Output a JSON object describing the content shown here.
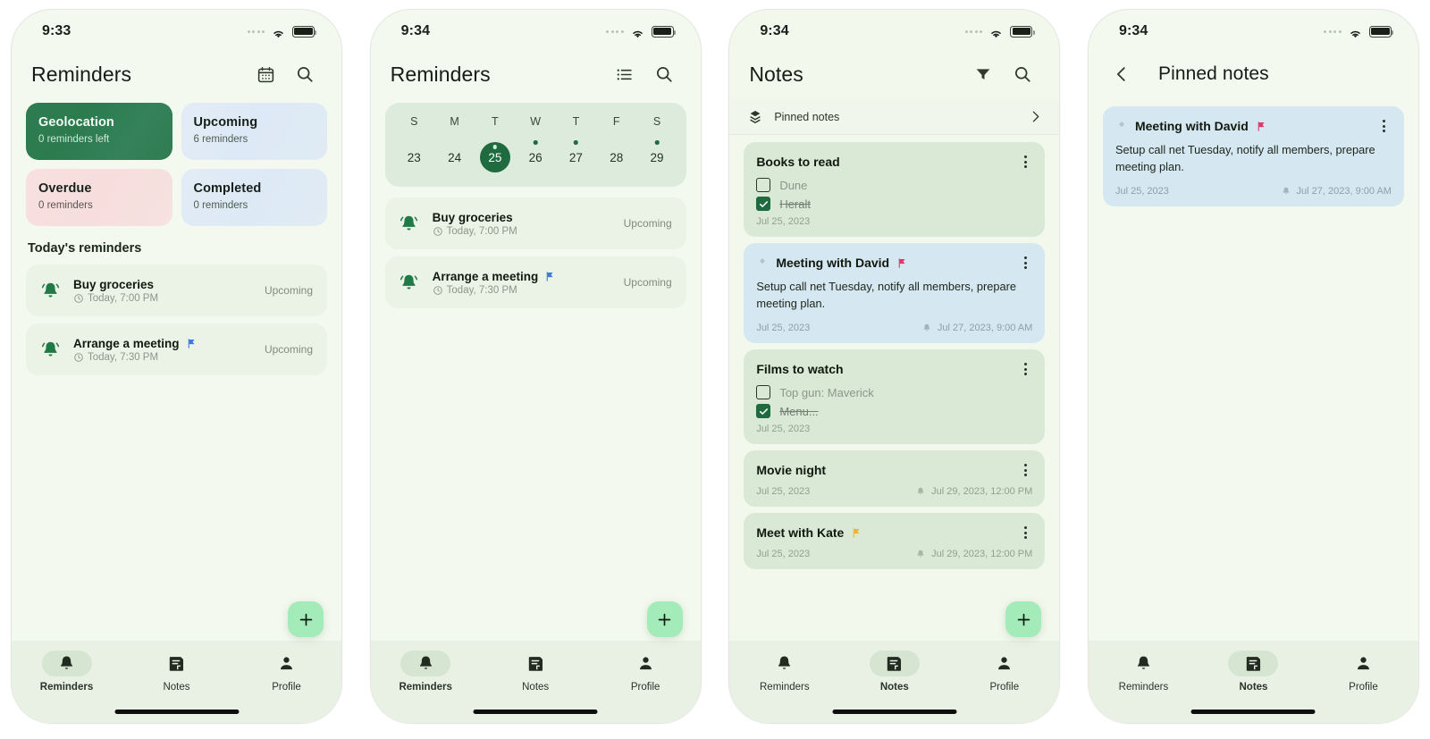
{
  "phones": [
    {
      "id": "reminders-home",
      "status": {
        "time": "9:33",
        "wifi_icon": "wifi-icon",
        "battery_icon": "battery-full-icon",
        "signal_icon": "signal-dots-icon"
      },
      "appbar": {
        "title": "Reminders",
        "icons": [
          "calendar-icon",
          "search-icon"
        ]
      },
      "tiles": [
        {
          "name": "Geolocation",
          "sub": "0 reminders left",
          "style": "geo"
        },
        {
          "name": "Upcoming",
          "sub": "6 reminders",
          "style": "upcoming"
        },
        {
          "name": "Overdue",
          "sub": "0 reminders",
          "style": "overdue"
        },
        {
          "name": "Completed",
          "sub": "0 reminders",
          "style": "completed"
        }
      ],
      "section_title": "Today's reminders",
      "reminders": [
        {
          "title": "Buy groceries",
          "time": "Today, 7:00 PM",
          "status": "Upcoming",
          "flag": false
        },
        {
          "title": "Arrange a meeting",
          "time": "Today, 7:30 PM",
          "status": "Upcoming",
          "flag": true,
          "flag_color": "#3f76e0"
        }
      ],
      "fab": {
        "label": "+",
        "name": "add-reminder-fab"
      },
      "nav": {
        "active": "Reminders",
        "items": [
          {
            "label": "Reminders",
            "icon": "bell-icon"
          },
          {
            "label": "Notes",
            "icon": "note-icon"
          },
          {
            "label": "Profile",
            "icon": "person-icon"
          }
        ]
      }
    },
    {
      "id": "reminders-calendar",
      "status": {
        "time": "9:34",
        "wifi_icon": "wifi-icon",
        "battery_icon": "battery-full-icon",
        "signal_icon": "signal-dots-icon"
      },
      "appbar": {
        "title": "Reminders",
        "icons": [
          "list-view-icon",
          "search-icon"
        ]
      },
      "calendar": {
        "dow": [
          "S",
          "M",
          "T",
          "W",
          "T",
          "F",
          "S"
        ],
        "days": [
          {
            "num": "23",
            "dot": false,
            "selected": false
          },
          {
            "num": "24",
            "dot": false,
            "selected": false
          },
          {
            "num": "25",
            "dot": true,
            "selected": true
          },
          {
            "num": "26",
            "dot": true,
            "selected": false
          },
          {
            "num": "27",
            "dot": true,
            "selected": false
          },
          {
            "num": "28",
            "dot": false,
            "selected": false
          },
          {
            "num": "29",
            "dot": true,
            "selected": false
          }
        ]
      },
      "reminders": [
        {
          "title": "Buy groceries",
          "time": "Today, 7:00 PM",
          "status": "Upcoming",
          "flag": false
        },
        {
          "title": "Arrange a meeting",
          "time": "Today, 7:30 PM",
          "status": "Upcoming",
          "flag": true,
          "flag_color": "#3f76e0"
        }
      ],
      "fab": {
        "label": "+",
        "name": "add-reminder-fab"
      },
      "nav": {
        "active": "Reminders",
        "items": [
          {
            "label": "Reminders",
            "icon": "bell-icon"
          },
          {
            "label": "Notes",
            "icon": "note-icon"
          },
          {
            "label": "Profile",
            "icon": "person-icon"
          }
        ]
      }
    },
    {
      "id": "notes-list",
      "status": {
        "time": "9:34",
        "wifi_icon": "wifi-icon",
        "battery_icon": "battery-full-icon",
        "signal_icon": "signal-dots-icon"
      },
      "appbar": {
        "title": "Notes",
        "icons": [
          "filter-icon",
          "search-icon"
        ]
      },
      "pinned_row": {
        "label": "Pinned notes",
        "icon": "pin-stack-icon",
        "chevron": "chevron-right-icon"
      },
      "notes": [
        {
          "title": "Books to read",
          "color": "green",
          "pinned": false,
          "flag": null,
          "checklist": [
            {
              "text": "Dune",
              "checked": false
            },
            {
              "text": "Heralt",
              "checked": true
            }
          ],
          "body": null,
          "date": "Jul 25, 2023",
          "alarm": null
        },
        {
          "title": "Meeting with David",
          "color": "blue",
          "pinned": true,
          "flag": "#e0366b",
          "checklist": [],
          "body": "Setup call net Tuesday, notify all members, prepare meeting plan.",
          "date": "Jul 25, 2023",
          "alarm": "Jul 27, 2023, 9:00 AM"
        },
        {
          "title": "Films to watch",
          "color": "green",
          "pinned": false,
          "flag": null,
          "checklist": [
            {
              "text": "Top gun: Maverick",
              "checked": false
            },
            {
              "text": "Menu...",
              "checked": true
            }
          ],
          "body": null,
          "date": "Jul 25, 2023",
          "alarm": null
        },
        {
          "title": "Movie night",
          "color": "green",
          "pinned": false,
          "flag": null,
          "checklist": [],
          "body": null,
          "date": "Jul 25, 2023",
          "alarm": "Jul 29, 2023, 12:00 PM"
        },
        {
          "title": "Meet with Kate",
          "color": "green",
          "pinned": false,
          "flag": "#f0b429",
          "checklist": [],
          "body": null,
          "date": "Jul 25, 2023",
          "alarm": "Jul 29, 2023, 12:00 PM"
        }
      ],
      "fab": {
        "label": "+",
        "name": "add-note-fab"
      },
      "nav": {
        "active": "Notes",
        "items": [
          {
            "label": "Reminders",
            "icon": "bell-icon"
          },
          {
            "label": "Notes",
            "icon": "note-icon"
          },
          {
            "label": "Profile",
            "icon": "person-icon"
          }
        ]
      }
    },
    {
      "id": "pinned-notes",
      "status": {
        "time": "9:34",
        "wifi_icon": "wifi-icon",
        "battery_icon": "battery-full-icon",
        "signal_icon": "signal-dots-icon"
      },
      "appbar": {
        "title": "Pinned notes",
        "back_icon": "chevron-left-icon",
        "icons": []
      },
      "notes": [
        {
          "title": "Meeting with David",
          "color": "blue",
          "pinned": true,
          "flag": "#e0366b",
          "checklist": [],
          "body": "Setup call net Tuesday, notify all members, prepare meeting plan.",
          "date": "Jul 25, 2023",
          "alarm": "Jul 27, 2023, 9:00 AM"
        }
      ],
      "nav": {
        "active": "Notes",
        "items": [
          {
            "label": "Reminders",
            "icon": "bell-icon"
          },
          {
            "label": "Notes",
            "icon": "note-icon"
          },
          {
            "label": "Profile",
            "icon": "person-icon"
          }
        ]
      }
    }
  ],
  "theme": {
    "accent_green": "#1f6b3f",
    "fab_green": "#a3ebb8",
    "note_green": "#d9e9d6",
    "note_blue": "#d5e7f1",
    "screen_bg": "#f4f9ef",
    "nav_bg": "#e9f1e5"
  }
}
